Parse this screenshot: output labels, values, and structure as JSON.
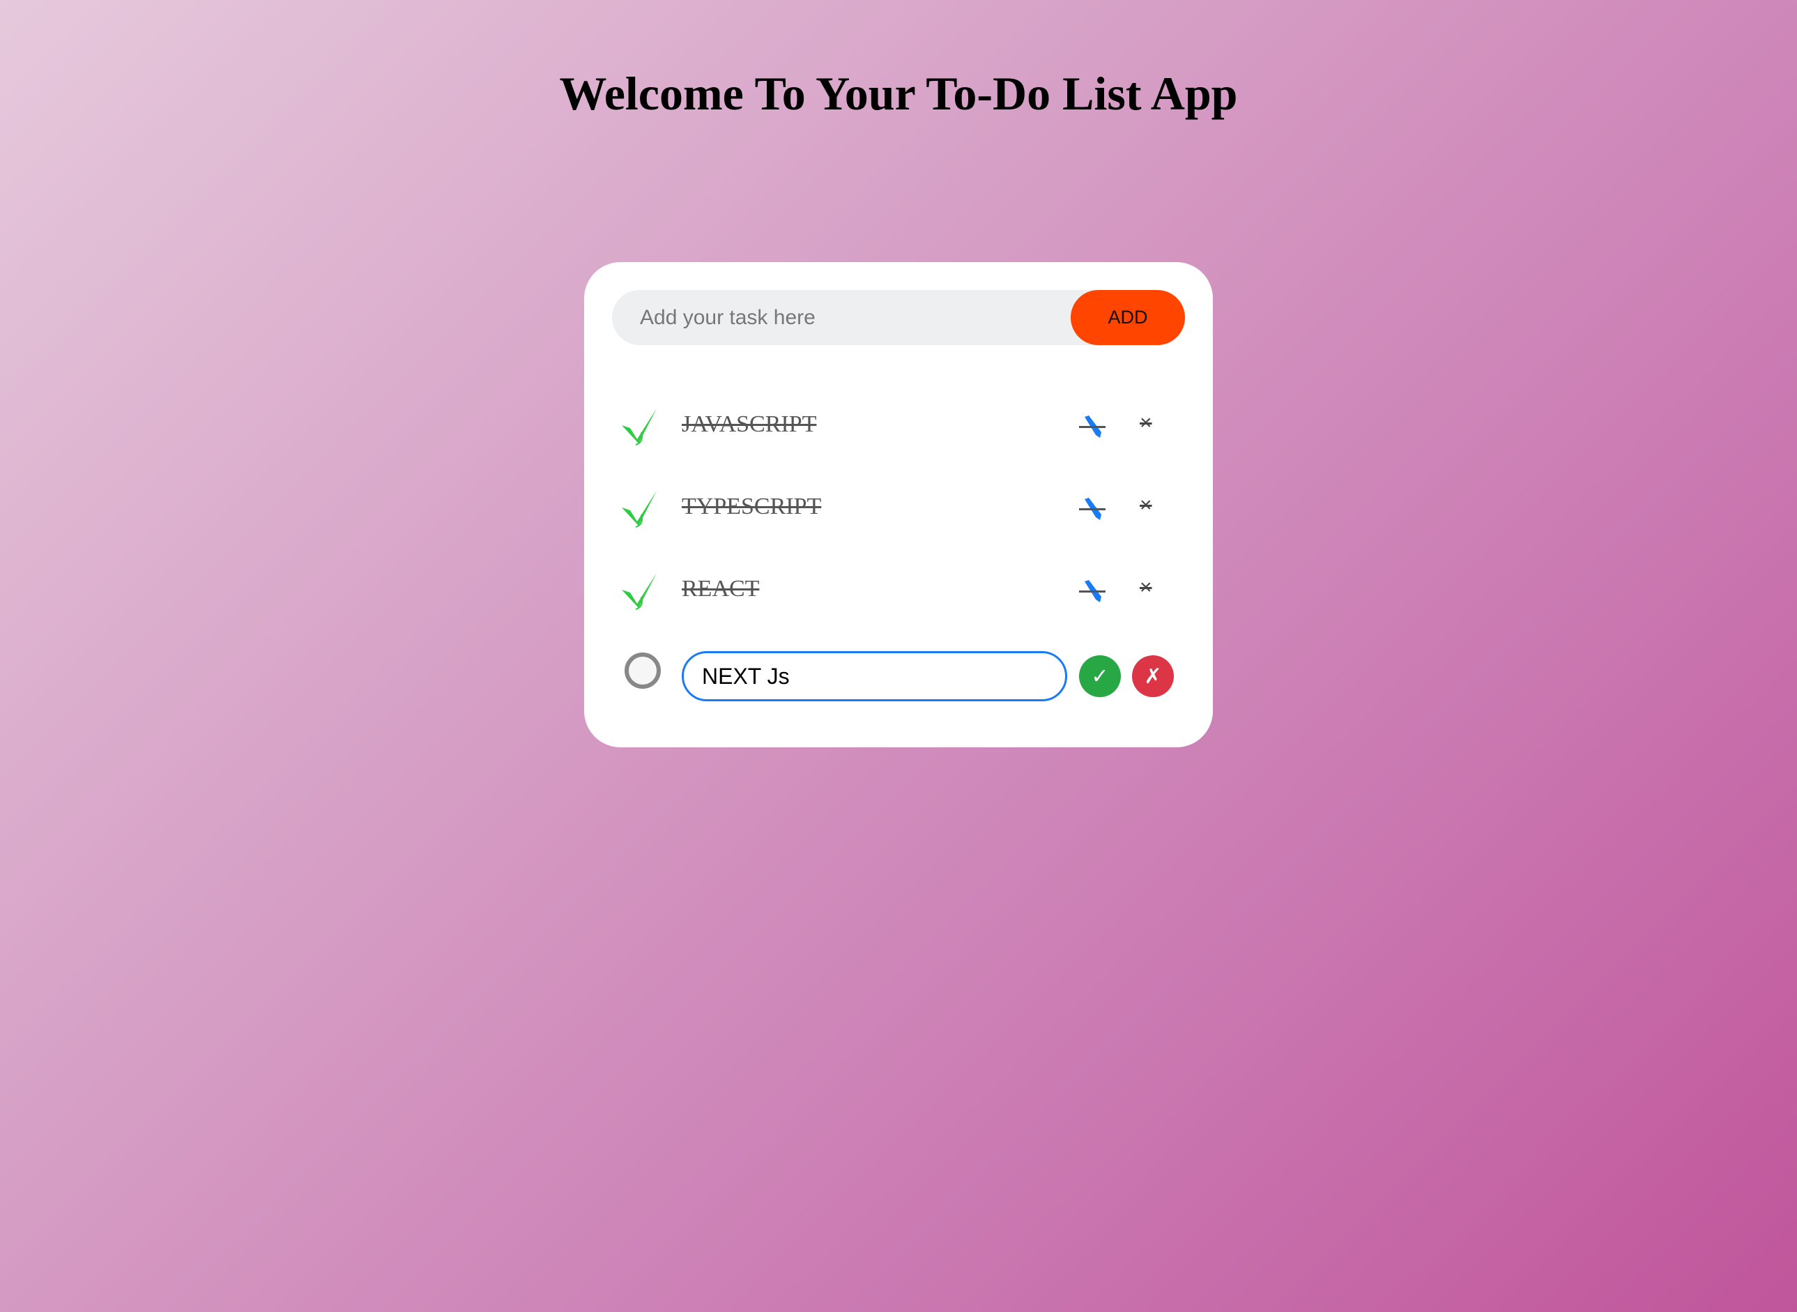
{
  "title": "Welcome To Your To-Do List App",
  "add": {
    "placeholder": "Add your task here",
    "value": "",
    "button_label": "ADD"
  },
  "tasks": [
    {
      "label": "JAVASCRIPT",
      "done": true
    },
    {
      "label": "TYPESCRIPT",
      "done": true
    },
    {
      "label": "REACT",
      "done": true
    }
  ],
  "editing": {
    "value": "NEXT Js",
    "save_label": "✓",
    "cancel_label": "✗",
    "done": false
  },
  "icons": {
    "done": "check-icon",
    "edit": "pencil-icon",
    "delete": "close-icon",
    "pending": "circle-icon"
  },
  "colors": {
    "add_button": "#ff4500",
    "check": "#2ecc40",
    "edit": "#1a7cf5",
    "save": "#28a745",
    "cancel": "#dc3545"
  },
  "delete_glyph": "×"
}
